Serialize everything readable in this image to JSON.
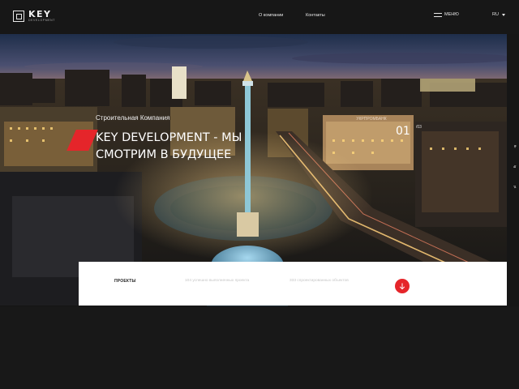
{
  "header": {
    "logo_word": "KEY",
    "logo_sub": "DEVELOPMENT",
    "nav": [
      "О компании",
      "Контакты"
    ],
    "menu_label": "МЕНЮ",
    "lang": "RU"
  },
  "hero": {
    "subtitle": "Строительная Компания",
    "title": "KEY DEVELOPMENT - МЫ СМОТРИМ В БУДУЩЕЕ",
    "counter_current": "01",
    "counter_total": "/03",
    "building_sign": "УКРПРОМБАНК"
  },
  "rail": [
    "fb",
    "ig",
    "yt"
  ],
  "info_bar": {
    "projects_label": "ПРОЕКТЫ",
    "stat_1": "104 успешно выполненных проекта",
    "stat_2": "333 спроектированных объектов"
  },
  "colors": {
    "accent": "#e5252a",
    "header_bg": "#171717"
  },
  "icons": {
    "logo": "house-icon",
    "menu": "hamburger-icon",
    "lang": "chevron-down-icon",
    "scroll": "arrow-down-icon"
  }
}
